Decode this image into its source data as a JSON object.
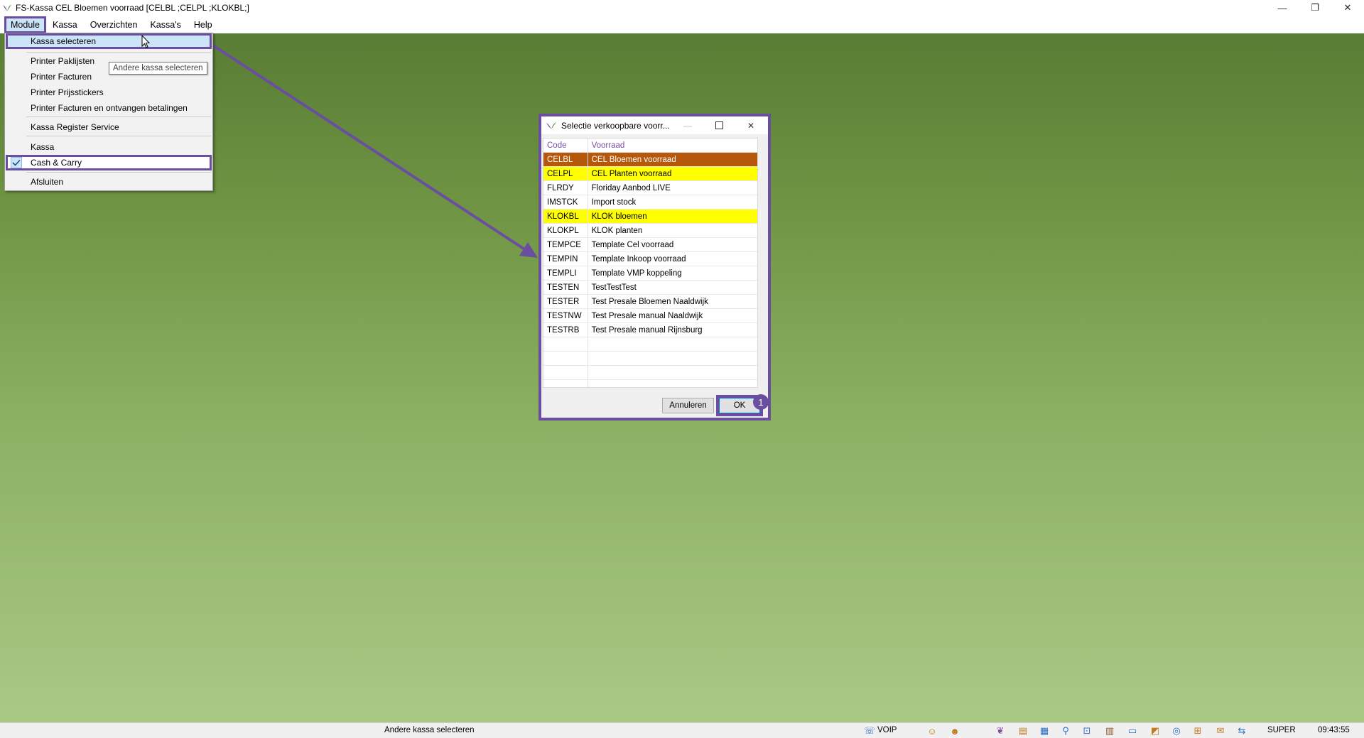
{
  "window": {
    "title": "FS-Kassa CEL Bloemen voorraad [CELBL ;CELPL ;KLOKBL;]",
    "controls": {
      "minimize": "—",
      "restore": "❐",
      "close": "✕"
    }
  },
  "menubar": {
    "items": [
      {
        "label": "Module"
      },
      {
        "label": "Kassa"
      },
      {
        "label": "Overzichten"
      },
      {
        "label": "Kassa's"
      },
      {
        "label": "Help"
      }
    ]
  },
  "module_menu": {
    "items": [
      {
        "label": "Kassa selecteren"
      },
      {
        "label": "Printer Paklijsten"
      },
      {
        "label": "Printer Facturen"
      },
      {
        "label": "Printer Prijsstickers"
      },
      {
        "label": "Printer Facturen en ontvangen betalingen"
      },
      {
        "label": "Kassa Register Service"
      },
      {
        "label": "Kassa"
      },
      {
        "label": "Cash & Carry",
        "checked": true
      },
      {
        "label": "Afsluiten"
      }
    ],
    "tooltip": "Andere kassa selecteren"
  },
  "dialog": {
    "title": "Selectie verkoopbare voorr...",
    "columns": {
      "code": "Code",
      "voorraad": "Voorraad"
    },
    "rows": [
      {
        "code": "CELBL",
        "voorraad": "CEL Bloemen voorraad",
        "state": "current"
      },
      {
        "code": "CELPL",
        "voorraad": "CEL Planten voorraad",
        "state": "selected"
      },
      {
        "code": "FLRDY",
        "voorraad": "Floriday Aanbod LIVE",
        "state": ""
      },
      {
        "code": "IMSTCK",
        "voorraad": "Import stock",
        "state": ""
      },
      {
        "code": "KLOKBL",
        "voorraad": "KLOK bloemen",
        "state": "selected"
      },
      {
        "code": "KLOKPL",
        "voorraad": "KLOK planten",
        "state": ""
      },
      {
        "code": "TEMPCE",
        "voorraad": "Template Cel voorraad",
        "state": ""
      },
      {
        "code": "TEMPIN",
        "voorraad": "Template Inkoop voorraad",
        "state": ""
      },
      {
        "code": "TEMPLI",
        "voorraad": "Template VMP koppeling",
        "state": ""
      },
      {
        "code": "TESTEN",
        "voorraad": "TestTestTest",
        "state": ""
      },
      {
        "code": "TESTER",
        "voorraad": "Test Presale Bloemen Naaldwijk",
        "state": ""
      },
      {
        "code": "TESTNW",
        "voorraad": "Test Presale manual Naaldwijk",
        "state": ""
      },
      {
        "code": "TESTRB",
        "voorraad": "Test Presale manual Rijnsburg",
        "state": ""
      }
    ],
    "cancel_label": "Annuleren",
    "ok_label": "OK",
    "step_badge": "1"
  },
  "statusbar": {
    "message": "Andere kassa selecteren",
    "voip": "VOIP",
    "user": "SUPER",
    "time": "09:43:55"
  },
  "colors": {
    "annotation": "#6a4fa0",
    "row_current": "#b5580c",
    "row_selected": "#ffff00",
    "header_text": "#7a4ea0"
  }
}
